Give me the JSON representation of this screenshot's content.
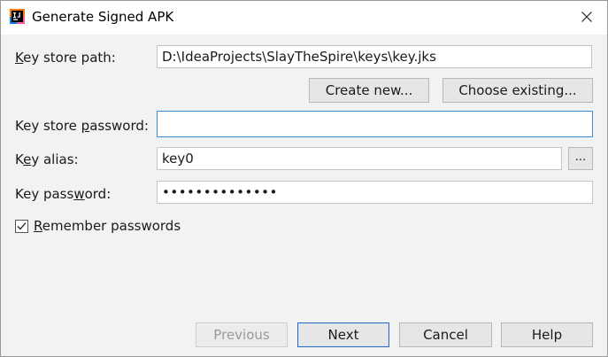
{
  "window": {
    "title": "Generate Signed APK",
    "app_icon": "intellij-idea-icon",
    "close_icon": "close-icon"
  },
  "form": {
    "key_store_path": {
      "label_pre": "",
      "label_mnemonic": "K",
      "label_post": "ey store path:",
      "value": "D:\\IdeaProjects\\SlayTheSpire\\keys\\key.jks"
    },
    "create_new_label": "Create new...",
    "choose_existing_label": "Choose existing...",
    "key_store_password": {
      "label_pre": "Key store ",
      "label_mnemonic": "p",
      "label_post": "assword:",
      "value": ""
    },
    "key_alias": {
      "label_pre": "K",
      "label_mnemonic": "e",
      "label_post": "y alias:",
      "value": "key0",
      "browse_label": "..."
    },
    "key_password": {
      "label_pre": "Key pass",
      "label_mnemonic": "w",
      "label_post": "ord:",
      "value": "••••••••••••••"
    },
    "remember_passwords": {
      "checked": true,
      "label_mnemonic": "R",
      "label_post": "emember passwords"
    }
  },
  "footer": {
    "previous_label": "Previous",
    "next_label": "Next",
    "cancel_label": "Cancel",
    "help_label": "Help"
  },
  "colors": {
    "focus_border": "#3c8fd6",
    "primary_border": "#2e6bb8",
    "dialog_bg": "#f2f2f2"
  }
}
